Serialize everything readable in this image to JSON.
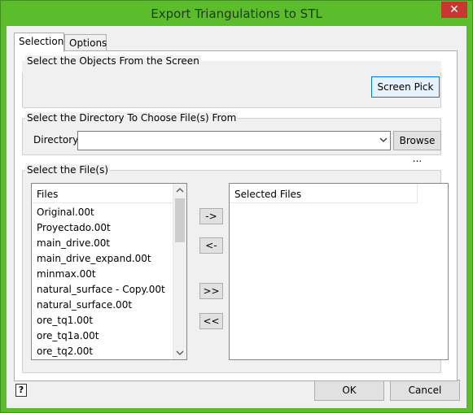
{
  "window": {
    "title": "Export Triangulations to STL",
    "close_glyph": "✕"
  },
  "tabs": [
    {
      "label": "Selection"
    },
    {
      "label": "Options"
    }
  ],
  "groups": {
    "screen": {
      "title": "Select the Objects From the Screen",
      "screen_pick_label": "Screen Pick"
    },
    "directory": {
      "title": "Select the Directory To Choose File(s) From",
      "directory_label": "Directory",
      "directory_value": "",
      "browse_label": "Browse ..."
    },
    "files": {
      "title": "Select the File(s)",
      "files_header": "Files",
      "selected_header": "Selected Files",
      "files": [
        "Original.00t",
        "Proyectado.00t",
        "main_drive.00t",
        "main_drive_expand.00t",
        "minmax.00t",
        "natural_surface - Copy.00t",
        "natural_surface.00t",
        "ore_tq1.00t",
        "ore_tq1a.00t",
        "ore_tq2.00t"
      ],
      "move_right_label": "->",
      "move_left_label": "<-",
      "move_all_right_label": ">>",
      "move_all_left_label": "<<"
    }
  },
  "footer": {
    "ok_label": "OK",
    "cancel_label": "Cancel",
    "help_glyph": "?"
  }
}
